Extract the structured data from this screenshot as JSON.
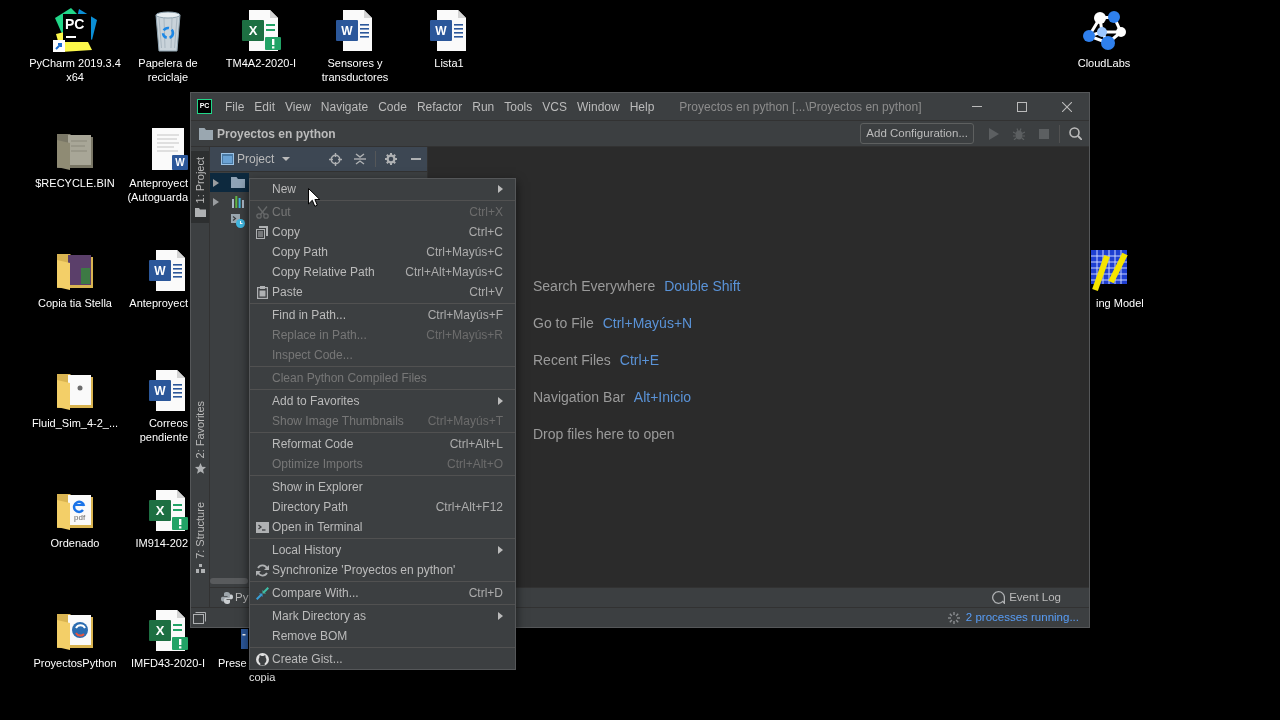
{
  "desktop": {
    "icons": [
      {
        "kind": "pycharm",
        "glyph": "PC",
        "label_lines": [
          "PyCharm 2019.3.4",
          "x64"
        ]
      },
      {
        "kind": "recycle_bin",
        "label_lines": [
          "Papelera de",
          "reciclaje"
        ]
      },
      {
        "kind": "excel",
        "glyph": "X",
        "label_lines": [
          "TM4A2-2020-I"
        ]
      },
      {
        "kind": "word",
        "glyph": "W",
        "label_lines": [
          "Sensores y",
          "transductores"
        ]
      },
      {
        "kind": "word",
        "glyph": "W",
        "label_lines": [
          "Lista1"
        ]
      },
      {
        "kind": "cloud",
        "label_lines": [
          "CloudLabs"
        ]
      },
      {
        "kind": "folder_gray",
        "label_lines": [
          "$RECYCLE.BIN"
        ]
      },
      {
        "kind": "document_thumbnail",
        "glyph": "W",
        "label_lines": [
          "Anteproyect",
          "(Autoguarda"
        ]
      },
      {
        "kind": "folder_photo",
        "label_lines": [
          "Copia tia Stella"
        ]
      },
      {
        "kind": "word",
        "glyph": "W",
        "label_lines": [
          "Anteproyect"
        ]
      },
      {
        "kind": "grid_app",
        "label_lines": [
          "ing Model"
        ]
      },
      {
        "kind": "folder_document",
        "label_lines": [
          "Fluid_Sim_4-2_..."
        ]
      },
      {
        "kind": "word",
        "glyph": "W",
        "label_lines": [
          "Correos",
          "pendiente"
        ]
      },
      {
        "kind": "folder_pdf",
        "glyph": "pdf",
        "label_lines": [
          "Ordenado"
        ]
      },
      {
        "kind": "excel",
        "glyph": "X",
        "label_lines": [
          "IM914-202"
        ]
      },
      {
        "kind": "folder_python",
        "label_lines": [
          "ProyectosPython"
        ]
      },
      {
        "kind": "excel",
        "glyph": "X",
        "label_lines": [
          "IMFD43-2020-I"
        ]
      },
      {
        "kind": "document_partial",
        "label_lines": [
          "Prese",
          "copia"
        ]
      }
    ]
  },
  "window": {
    "logo": "PC",
    "menu": [
      "File",
      "Edit",
      "View",
      "Navigate",
      "Code",
      "Refactor",
      "Run",
      "Tools",
      "VCS",
      "Window",
      "Help"
    ],
    "title": "Proyectos en python [...\\Proyectos en python]",
    "navigation_bar": {
      "project": "Proyectos en python",
      "add_configuration": "Add Configuration..."
    },
    "tool_stripe": [
      {
        "label": "1: Project",
        "selected": true
      },
      {
        "label": "2: Favorites",
        "selected": false
      },
      {
        "label": "7: Structure",
        "selected": false
      }
    ],
    "project_panel": {
      "title": "Project",
      "tree": [
        {
          "kind": "folder",
          "expandable": true,
          "selected": true
        },
        {
          "kind": "libraries",
          "expandable": true,
          "selected": false
        },
        {
          "kind": "scratches",
          "expandable": false,
          "selected": false
        }
      ]
    },
    "editor_hints": [
      {
        "label": "Search Everywhere",
        "shortcut": "Double Shift"
      },
      {
        "label": "Go to File",
        "shortcut": "Ctrl+Mayús+N"
      },
      {
        "label": "Recent Files",
        "shortcut": "Ctrl+E"
      },
      {
        "label": "Navigation Bar",
        "shortcut": "Alt+Inicio"
      },
      {
        "label": "Drop files here to open"
      }
    ],
    "bottom_bar": {
      "python_console": "Py",
      "event_log": "Event Log"
    },
    "status_bar": {
      "processes": "2 processes running..."
    }
  },
  "context_menu": {
    "groups": [
      {
        "items": [
          {
            "label": "New",
            "disabled": false,
            "submenu": true
          }
        ]
      },
      {
        "items": [
          {
            "label": "Cut",
            "shortcut": "Ctrl+X",
            "disabled": true,
            "submenu": false
          },
          {
            "label": "Copy",
            "shortcut": "Ctrl+C",
            "disabled": false,
            "submenu": false
          },
          {
            "label": "Copy Path",
            "shortcut": "Ctrl+Mayús+C",
            "disabled": false,
            "submenu": false
          },
          {
            "label": "Copy Relative Path",
            "shortcut": "Ctrl+Alt+Mayús+C",
            "disabled": false,
            "submenu": false
          },
          {
            "label": "Paste",
            "shortcut": "Ctrl+V",
            "disabled": false,
            "submenu": false
          }
        ]
      },
      {
        "items": [
          {
            "label": "Find in Path...",
            "shortcut": "Ctrl+Mayús+F",
            "disabled": false,
            "submenu": false
          },
          {
            "label": "Replace in Path...",
            "shortcut": "Ctrl+Mayús+R",
            "disabled": true,
            "submenu": false
          },
          {
            "label": "Inspect Code...",
            "disabled": true,
            "submenu": false
          }
        ]
      },
      {
        "items": [
          {
            "label": "Clean Python Compiled Files",
            "disabled": true,
            "submenu": false
          }
        ]
      },
      {
        "items": [
          {
            "label": "Add to Favorites",
            "disabled": false,
            "submenu": true
          },
          {
            "label": "Show Image Thumbnails",
            "shortcut": "Ctrl+Mayús+T",
            "disabled": true,
            "submenu": false
          }
        ]
      },
      {
        "items": [
          {
            "label": "Reformat Code",
            "shortcut": "Ctrl+Alt+L",
            "disabled": false,
            "submenu": false
          },
          {
            "label": "Optimize Imports",
            "shortcut": "Ctrl+Alt+O",
            "disabled": true,
            "submenu": false
          }
        ]
      },
      {
        "items": [
          {
            "label": "Show in Explorer",
            "disabled": false,
            "submenu": false
          },
          {
            "label": "Directory Path",
            "shortcut": "Ctrl+Alt+F12",
            "disabled": false,
            "submenu": false
          },
          {
            "label": "Open in Terminal",
            "disabled": false,
            "submenu": false
          }
        ]
      },
      {
        "items": [
          {
            "label": "Local History",
            "disabled": false,
            "submenu": true
          },
          {
            "label": "Synchronize 'Proyectos en python'",
            "disabled": false,
            "submenu": false
          }
        ]
      },
      {
        "items": [
          {
            "label": "Compare With...",
            "shortcut": "Ctrl+D",
            "disabled": false,
            "submenu": false
          }
        ]
      },
      {
        "items": [
          {
            "label": "Mark Directory as",
            "disabled": false,
            "submenu": true
          },
          {
            "label": "Remove BOM",
            "disabled": false,
            "submenu": false
          }
        ]
      },
      {
        "items": [
          {
            "label": "Create Gist...",
            "disabled": false,
            "submenu": false
          }
        ]
      }
    ]
  }
}
